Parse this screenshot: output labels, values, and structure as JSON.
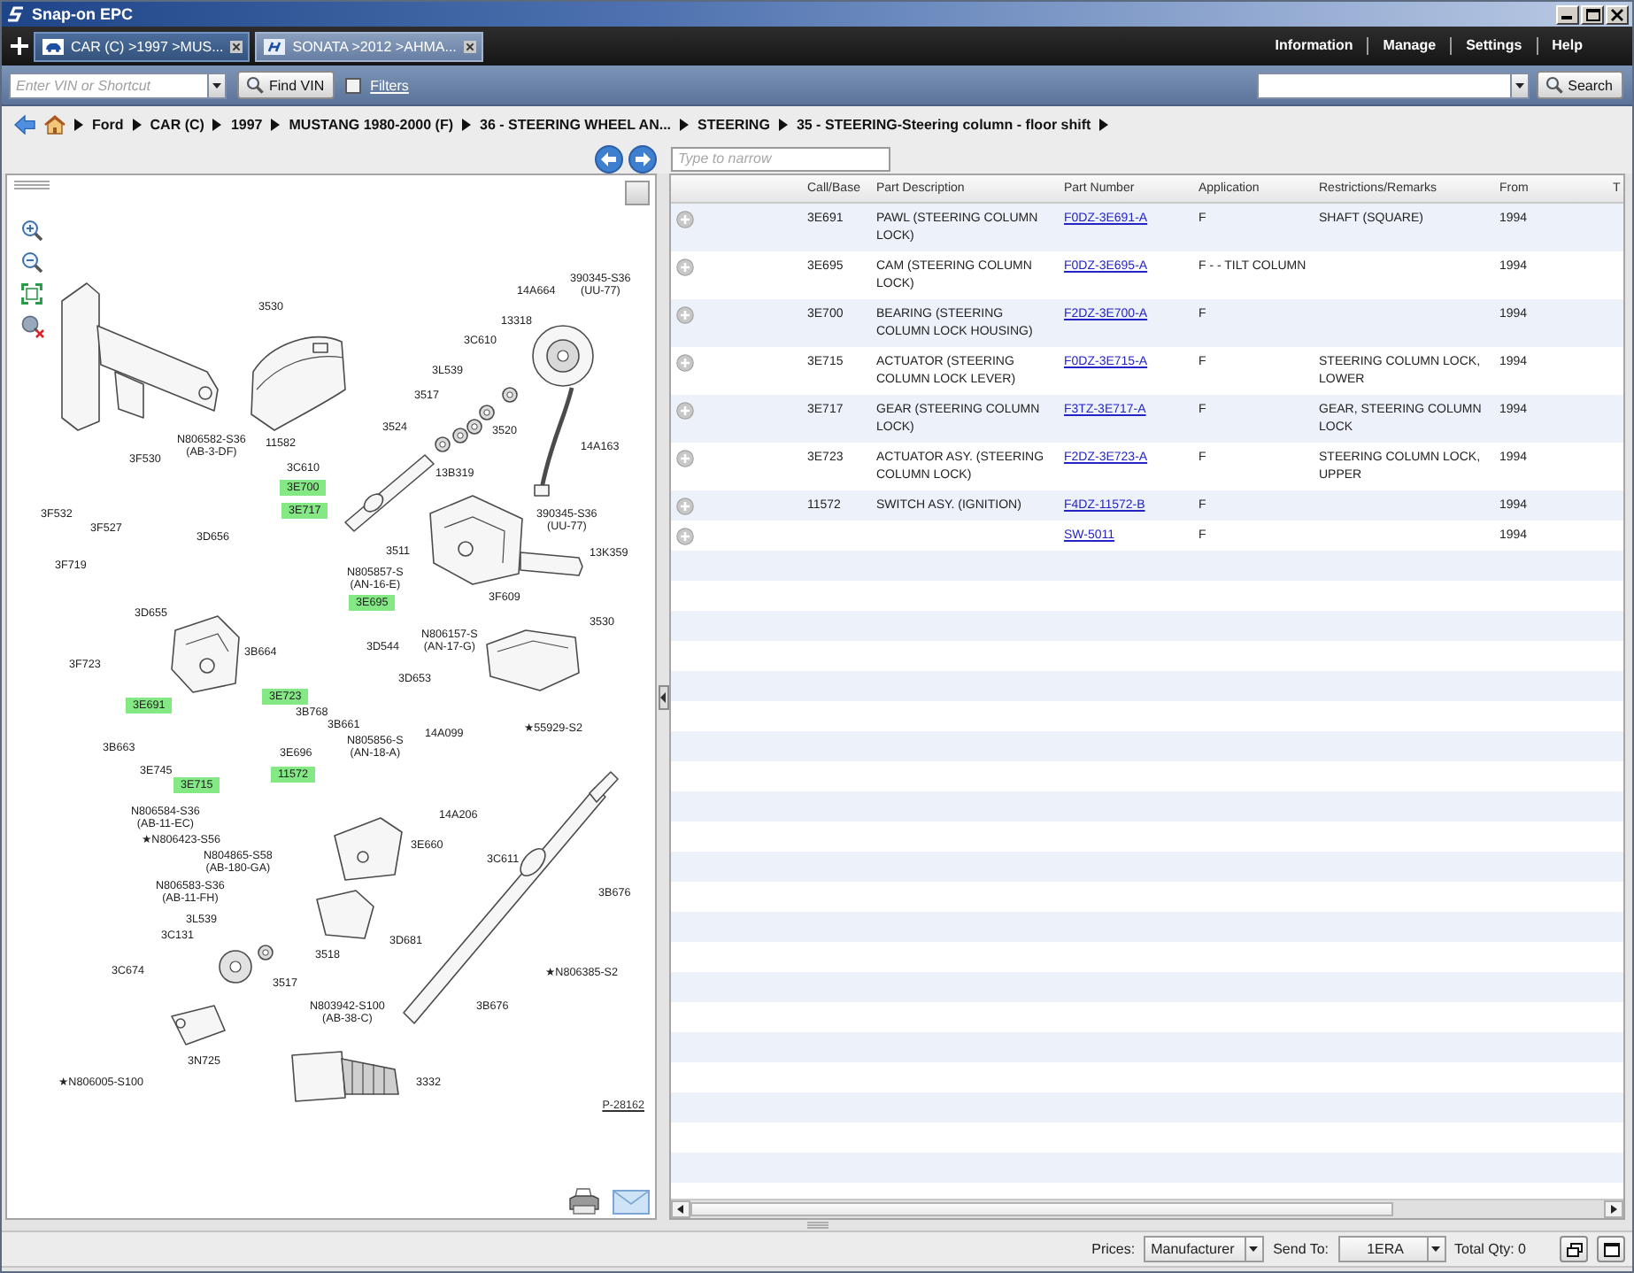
{
  "window": {
    "title": "Snap-on EPC"
  },
  "tabs": [
    {
      "label": "CAR (C) >1997 >MUS...",
      "kind": "car",
      "selected": true
    },
    {
      "label": "SONATA >2012 >AHMA...",
      "kind": "logo",
      "selected": false
    }
  ],
  "top_menu": [
    "Information",
    "Manage",
    "Settings",
    "Help"
  ],
  "toolbar": {
    "vin_field": {
      "placeholder": "Enter VIN or Shortcut"
    },
    "find_vin_button": "Find VIN",
    "filters": {
      "label": "Filters",
      "checked": false
    },
    "search_button": "Search"
  },
  "breadcrumb": [
    "Ford",
    "CAR (C)",
    "1997",
    "MUSTANG 1980-2000 (F)",
    "36 - STEERING WHEEL AN...",
    "STEERING",
    "35 - STEERING-Steering column - floor shift"
  ],
  "narrow_field": {
    "placeholder": "Type to narrow"
  },
  "diagram": {
    "callouts": [
      {
        "text": "14A664",
        "highlighted": false
      },
      {
        "text": "390345-S36",
        "note": "(UU-77)",
        "highlighted": false
      },
      {
        "text": "3530",
        "highlighted": false
      },
      {
        "text": "13318",
        "highlighted": false
      },
      {
        "text": "3C610",
        "highlighted": false
      },
      {
        "text": "3L539",
        "highlighted": false
      },
      {
        "text": "3517",
        "highlighted": false
      },
      {
        "text": "3524",
        "highlighted": false
      },
      {
        "text": "3520",
        "highlighted": false
      },
      {
        "text": "N806582-S36",
        "note": "(AB-3-DF)",
        "highlighted": false
      },
      {
        "text": "11582",
        "highlighted": false
      },
      {
        "text": "14A163",
        "highlighted": false
      },
      {
        "text": "3F530",
        "highlighted": false
      },
      {
        "text": "3C610",
        "highlighted": false
      },
      {
        "text": "13B319",
        "highlighted": false
      },
      {
        "text": "3E700",
        "highlighted": true
      },
      {
        "text": "3F532",
        "highlighted": false
      },
      {
        "text": "3E717",
        "highlighted": true
      },
      {
        "text": "3F527",
        "highlighted": false
      },
      {
        "text": "390345-S36",
        "note": "(UU-77)",
        "highlighted": false
      },
      {
        "text": "3D656",
        "highlighted": false
      },
      {
        "text": "3511",
        "highlighted": false
      },
      {
        "text": "13K359",
        "highlighted": false
      },
      {
        "text": "3F719",
        "highlighted": false
      },
      {
        "text": "N805857-S",
        "note": "(AN-16-E)",
        "highlighted": false
      },
      {
        "text": "3E695",
        "highlighted": true
      },
      {
        "text": "3F609",
        "highlighted": false
      },
      {
        "text": "3D655",
        "highlighted": false
      },
      {
        "text": "3530",
        "highlighted": false
      },
      {
        "text": "3B664",
        "highlighted": false
      },
      {
        "text": "3D544",
        "highlighted": false
      },
      {
        "text": "N806157-S",
        "note": "(AN-17-G)",
        "highlighted": false
      },
      {
        "text": "3F723",
        "highlighted": false
      },
      {
        "text": "3D653",
        "highlighted": false
      },
      {
        "text": "3E691",
        "highlighted": true
      },
      {
        "text": "3E723",
        "highlighted": true
      },
      {
        "text": "3B768",
        "highlighted": false
      },
      {
        "text": "3B661",
        "highlighted": false
      },
      {
        "text": "14A099",
        "highlighted": false
      },
      {
        "text": "★55929-S2",
        "highlighted": false
      },
      {
        "text": "3B663",
        "highlighted": false
      },
      {
        "text": "3E696",
        "highlighted": false
      },
      {
        "text": "N805856-S",
        "note": "(AN-18-A)",
        "highlighted": false
      },
      {
        "text": "3E745",
        "highlighted": false
      },
      {
        "text": "11572",
        "highlighted": true
      },
      {
        "text": "3E715",
        "highlighted": true
      },
      {
        "text": "N806584-S36",
        "note": "(AB-11-EC)",
        "highlighted": false
      },
      {
        "text": "14A206",
        "highlighted": false
      },
      {
        "text": "★N806423-S56",
        "highlighted": false
      },
      {
        "text": "3E660",
        "highlighted": false
      },
      {
        "text": "N804865-S58",
        "note": "(AB-180-GA)",
        "highlighted": false
      },
      {
        "text": "3C611",
        "highlighted": false
      },
      {
        "text": "N806583-S36",
        "note": "(AB-11-FH)",
        "highlighted": false
      },
      {
        "text": "3B676",
        "highlighted": false
      },
      {
        "text": "3L539",
        "highlighted": false
      },
      {
        "text": "3C131",
        "highlighted": false
      },
      {
        "text": "3D681",
        "highlighted": false
      },
      {
        "text": "3518",
        "highlighted": false
      },
      {
        "text": "3C674",
        "highlighted": false
      },
      {
        "text": "★N806385-S2",
        "highlighted": false
      },
      {
        "text": "3517",
        "highlighted": false
      },
      {
        "text": "N803942-S100",
        "note": "(AB-38-C)",
        "highlighted": false
      },
      {
        "text": "3B676",
        "highlighted": false
      },
      {
        "text": "3N725",
        "highlighted": false
      },
      {
        "text": "★N806005-S100",
        "highlighted": false
      },
      {
        "text": "3332",
        "highlighted": false
      }
    ],
    "drawing_number": "P-28162"
  },
  "table": {
    "columns": [
      "Call/Base",
      "Part Description",
      "Part Number",
      "Application",
      "Restrictions/Remarks",
      "From",
      "T"
    ],
    "rows": [
      {
        "call_base": "3E691",
        "description": "PAWL (STEERING COLUMN LOCK)",
        "part_number": "F0DZ-3E691-A",
        "application": "F",
        "remarks": "SHAFT (SQUARE)",
        "from": "1994"
      },
      {
        "call_base": "3E695",
        "description": "CAM (STEERING COLUMN LOCK)",
        "part_number": "F0DZ-3E695-A",
        "application": "F - - TILT COLUMN",
        "from": "1994"
      },
      {
        "call_base": "3E700",
        "description": "BEARING (STEERING COLUMN LOCK HOUSING)",
        "part_number": "F2DZ-3E700-A",
        "application": "F",
        "from": "1994"
      },
      {
        "call_base": "3E715",
        "description": "ACTUATOR (STEERING COLUMN LOCK LEVER)",
        "part_number": "F0DZ-3E715-A",
        "application": "F",
        "remarks": "STEERING COLUMN LOCK, LOWER",
        "from": "1994"
      },
      {
        "call_base": "3E717",
        "description": "GEAR (STEERING COLUMN LOCK)",
        "part_number": "F3TZ-3E717-A",
        "application": "F",
        "remarks": "GEAR, STEERING COLUMN LOCK",
        "from": "1994"
      },
      {
        "call_base": "3E723",
        "description": "ACTUATOR ASY. (STEERING COLUMN LOCK)",
        "part_number": "F2DZ-3E723-A",
        "application": "F",
        "remarks": "STEERING COLUMN LOCK, UPPER",
        "from": "1994"
      },
      {
        "call_base": "11572",
        "description": "SWITCH ASY. (IGNITION)",
        "part_number": "F4DZ-11572-B",
        "application": "F",
        "from": "1994"
      },
      {
        "part_number": "SW-5011",
        "application": "F",
        "from": "1994"
      }
    ]
  },
  "status_bar": {
    "prices_label": "Prices:",
    "prices": "Manufacturer",
    "send_to_label": "Send To:",
    "send_to": "1ERA",
    "total_qty": "Total Qty: 0"
  }
}
